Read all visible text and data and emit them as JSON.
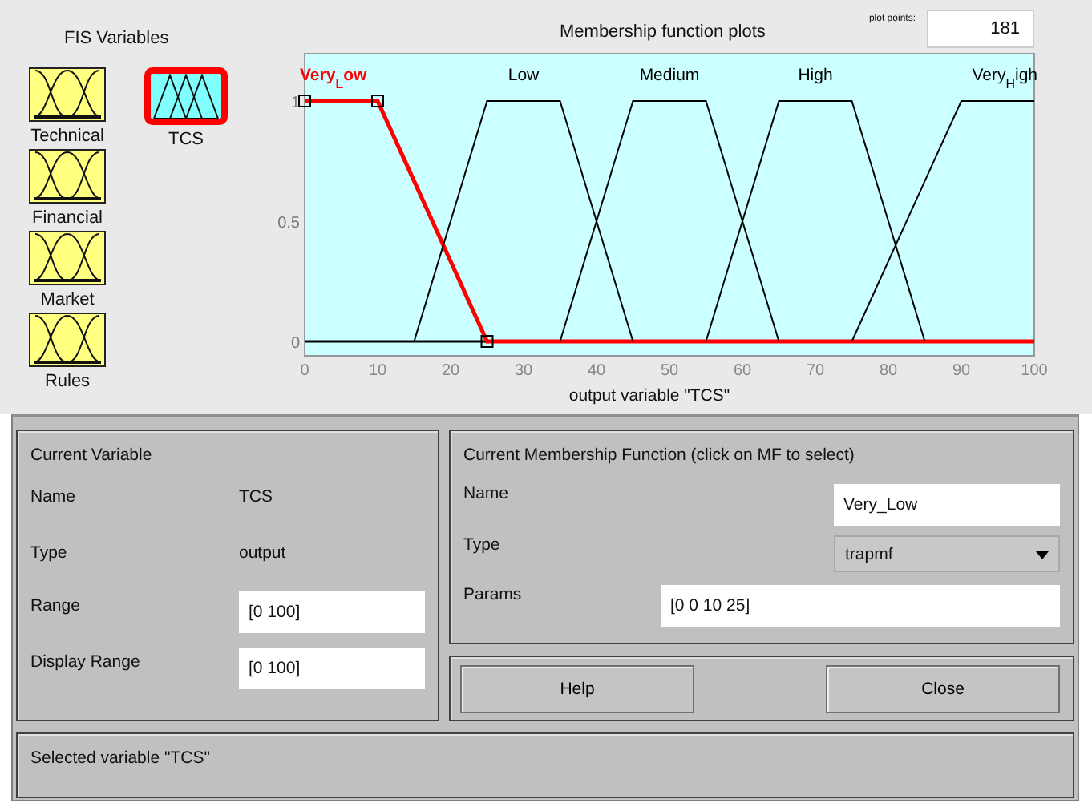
{
  "fis_variables": {
    "title": "FIS Variables",
    "items": [
      {
        "label": "Technical",
        "kind": "input",
        "selected": false
      },
      {
        "label": "TCS",
        "kind": "output",
        "selected": true
      },
      {
        "label": "Financial",
        "kind": "input",
        "selected": false
      },
      {
        "label": "Market",
        "kind": "input",
        "selected": false
      },
      {
        "label": "Rules",
        "kind": "rules",
        "selected": false
      }
    ]
  },
  "plot": {
    "curves": [
      {
        "selected": true
      },
      {
        "selected": false
      },
      {
        "selected": false
      },
      {
        "selected": false
      },
      {
        "selected": false
      }
    ],
    "plot_points_label": "plot points:",
    "plot_points": "181",
    "chart_data": {
      "type": "line",
      "title": "Membership function plots",
      "xlabel": "output variable \"TCS\"",
      "x": [
        0,
        10,
        15,
        25,
        35,
        45,
        55,
        65,
        75,
        85,
        90,
        100
      ],
      "series": [
        {
          "name": "Very$_{L}$ow",
          "color": "#ff0000",
          "values": [
            1,
            1,
            0.667,
            0,
            0,
            0,
            0,
            0,
            0,
            0,
            0,
            0
          ]
        },
        {
          "name": "Low",
          "color": "#000000",
          "values": [
            null,
            null,
            0,
            1,
            1,
            0,
            null,
            null,
            null,
            null,
            null,
            null
          ]
        },
        {
          "name": "Medium",
          "color": "#000000",
          "values": [
            null,
            null,
            null,
            null,
            0,
            1,
            1,
            0,
            null,
            null,
            null,
            null
          ]
        },
        {
          "name": "High",
          "color": "#000000",
          "values": [
            null,
            null,
            null,
            null,
            null,
            null,
            0,
            1,
            1,
            0,
            null,
            null
          ]
        },
        {
          "name": "Very$_{H}$igh",
          "color": "#000000",
          "values": [
            null,
            null,
            null,
            null,
            null,
            null,
            null,
            null,
            0,
            0.667,
            1,
            1
          ]
        }
      ],
      "xlim": [
        0,
        100
      ],
      "ylim": [
        -0.06,
        1.2
      ],
      "xticks": [
        0,
        10,
        20,
        30,
        40,
        50,
        60,
        70,
        80,
        90,
        100
      ],
      "yticks": [
        0,
        0.5,
        1
      ]
    }
  },
  "current_variable": {
    "title": "Current Variable",
    "name_label": "Name",
    "name": "TCS",
    "type_label": "Type",
    "type": "output",
    "range_label": "Range",
    "range": "[0 100]",
    "display_range_label": "Display Range",
    "display_range": "[0 100]"
  },
  "current_mf": {
    "title": "Current Membership Function (click on MF to select)",
    "name_label": "Name",
    "name": "Very_Low",
    "type_label": "Type",
    "type": "trapmf",
    "params_label": "Params",
    "params": "[0 0 10 25]"
  },
  "buttons": [
    "Help",
    "Close"
  ],
  "status": "Selected variable \"TCS\""
}
